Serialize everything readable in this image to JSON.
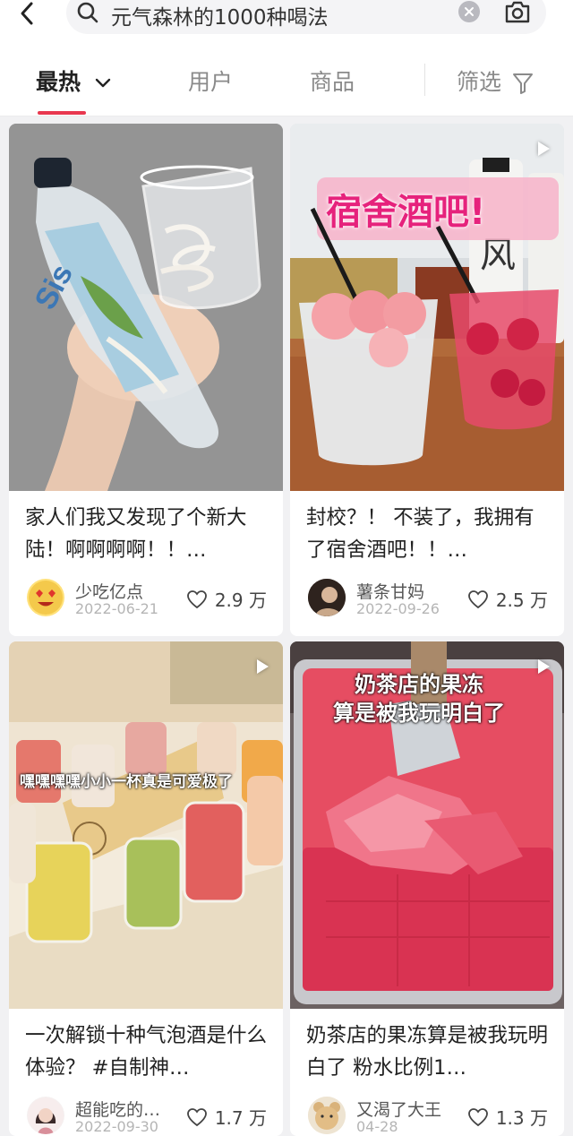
{
  "search": {
    "query": "元气森林的1000种喝法"
  },
  "tabs": [
    {
      "label": "最热"
    },
    {
      "label": "用户"
    },
    {
      "label": "商品"
    },
    {
      "label": "筛选"
    }
  ],
  "notes": [
    {
      "title": "家人们我又发现了个新大陆！啊啊啊啊！！…",
      "author": "少吃亿点",
      "date": "2022-06-21",
      "likes": "2.9 万",
      "is_video": false,
      "overlay": ""
    },
    {
      "title": "封校？！ 不装了，我拥有了宿舍酒吧！！…",
      "author": "薯条甘妈",
      "date": "2022-09-26",
      "likes": "2.5 万",
      "is_video": true,
      "overlay": "宿舍酒吧!"
    },
    {
      "title": "一次解锁十种气泡酒是什么体验？ #自制神…",
      "author": "超能吃的…",
      "date": "2022-09-30",
      "likes": "1.7 万",
      "is_video": true,
      "overlay": "嘿嘿嘿嘿小小一杯真是可爱极了"
    },
    {
      "title": "奶茶店的果冻算是被我玩明白了 粉水比例1…",
      "author": "又渴了大王",
      "date": "04-28",
      "likes": "1.3 万",
      "is_video": true,
      "overlay_lines": [
        "奶茶店的果冻",
        "算是被我玩明白了"
      ]
    }
  ],
  "colors": {
    "accent": "#e8384f",
    "page_bg": "#f1f1f3"
  }
}
